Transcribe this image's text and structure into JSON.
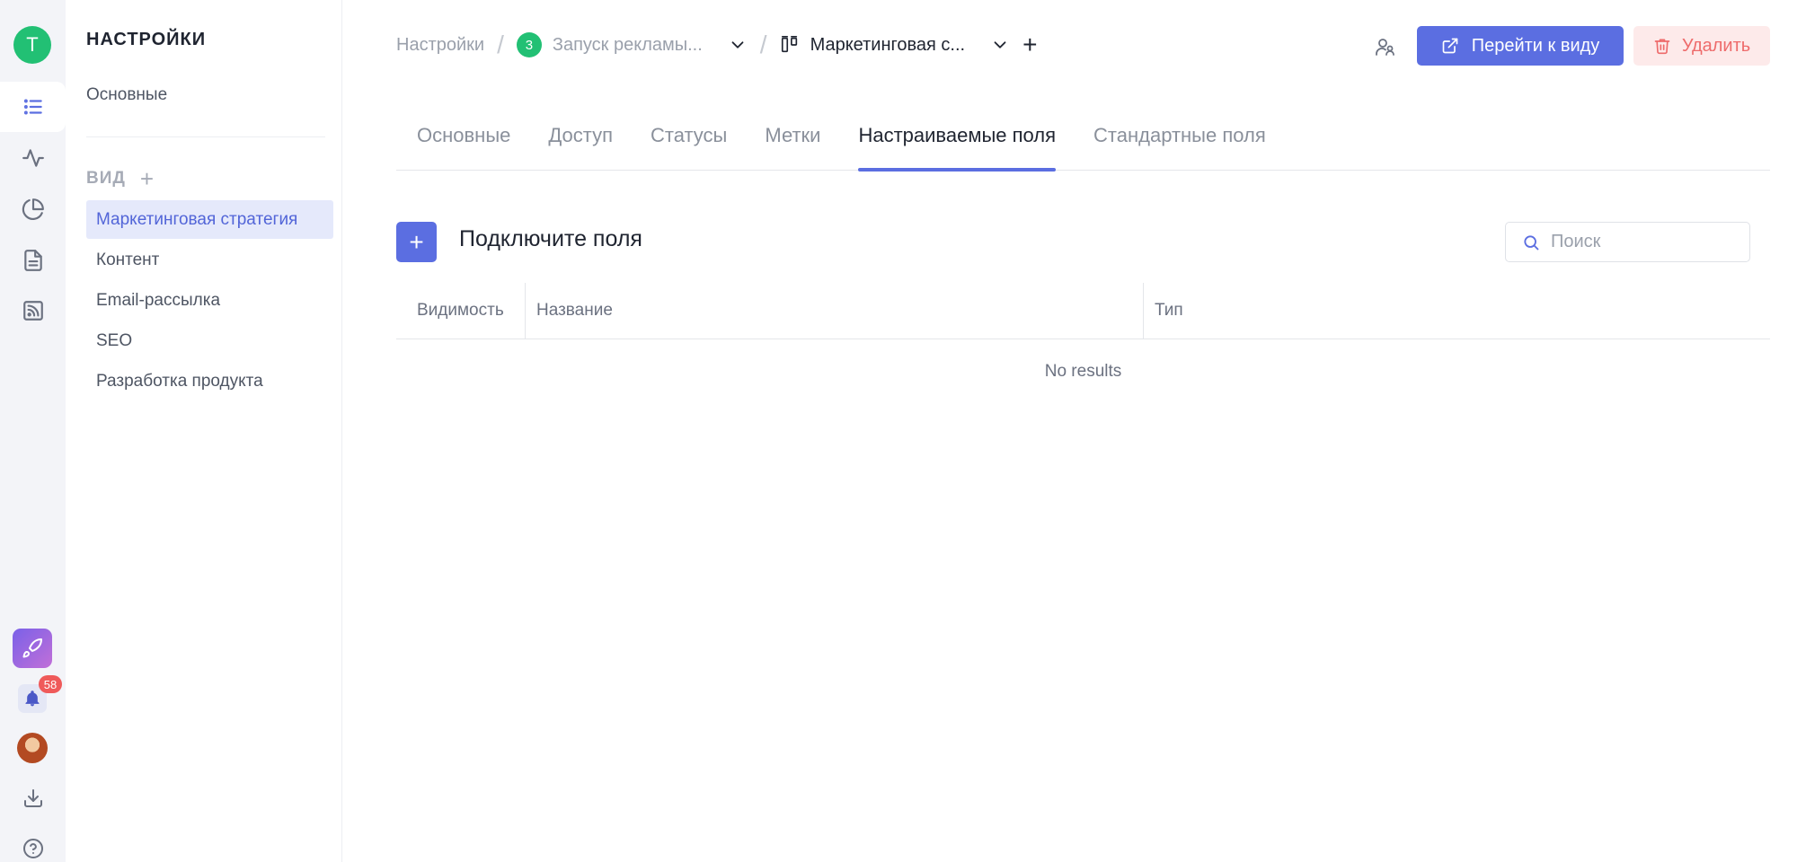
{
  "workspace": {
    "initial": "T",
    "color": "#22c074"
  },
  "rail": {
    "items": [
      {
        "icon": "list-icon",
        "active": true
      },
      {
        "icon": "activity-icon",
        "active": false
      },
      {
        "icon": "pie-chart-icon",
        "active": false
      },
      {
        "icon": "document-icon",
        "active": false
      },
      {
        "icon": "rss-icon",
        "active": false
      }
    ],
    "notifications_count": "58"
  },
  "sidebar": {
    "title": "НАСТРОЙКИ",
    "general": "Основные",
    "view_section": "ВИД",
    "views": [
      "Маркетинговая стратегия",
      "Контент",
      "Email-рассылка",
      "SEO",
      "Разработка продукта"
    ]
  },
  "breadcrumb": {
    "root": "Настройки",
    "project_number": "3",
    "project": "Запуск рекламы...",
    "view": "Маркетинговая с..."
  },
  "header": {
    "open_view": "Перейти к виду",
    "delete": "Удалить"
  },
  "tabs": [
    "Основные",
    "Доступ",
    "Статусы",
    "Метки",
    "Настраиваемые поля",
    "Стандартные поля"
  ],
  "active_tab": 4,
  "fields": {
    "add_label": "+",
    "title": "Подключите поля",
    "search_placeholder": "Поиск",
    "columns": [
      "Видимость",
      "Название",
      "Тип"
    ],
    "empty": "No results"
  },
  "colors": {
    "accent": "#5b6ee1",
    "danger": "#ee6b6b",
    "success": "#22c074"
  }
}
